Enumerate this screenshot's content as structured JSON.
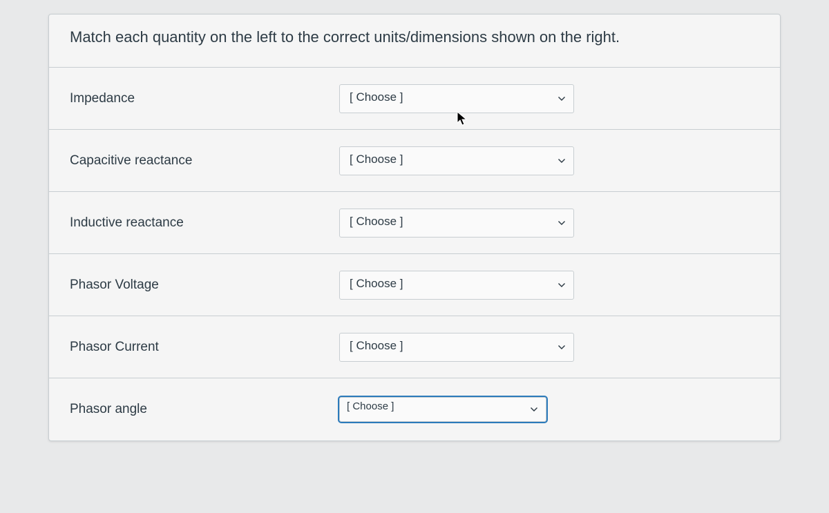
{
  "question": {
    "prompt": "Match each quantity on the left to the correct units/dimensions shown on the right."
  },
  "items": [
    {
      "label": "Impedance",
      "selected": "[ Choose ]",
      "focused": false
    },
    {
      "label": "Capacitive reactance",
      "selected": "[ Choose ]",
      "focused": false
    },
    {
      "label": "Inductive reactance",
      "selected": "[ Choose ]",
      "focused": false
    },
    {
      "label": "Phasor Voltage",
      "selected": "[ Choose ]",
      "focused": false
    },
    {
      "label": "Phasor Current",
      "selected": "[ Choose ]",
      "focused": false
    },
    {
      "label": "Phasor angle",
      "selected": "[ Choose ]",
      "focused": true
    }
  ]
}
